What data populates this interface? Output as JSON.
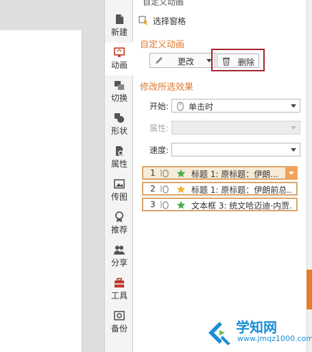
{
  "panel": {
    "title": "自定义动画",
    "select_pane_label": "选择窗格",
    "custom_section_title": "自定义动画",
    "modify_button_label": "更改",
    "delete_button_label": "删除",
    "effect_section_title": "修改所选效果",
    "start_label": "开始:",
    "start_value": "单击时",
    "property_label": "属性:",
    "speed_label": "速度:",
    "speed_value": ""
  },
  "sidebar": {
    "items": [
      {
        "label": "新建",
        "icon": "new-doc-icon"
      },
      {
        "label": "动画",
        "icon": "animation-icon"
      },
      {
        "label": "切换",
        "icon": "transition-icon"
      },
      {
        "label": "形状",
        "icon": "shape-icon"
      },
      {
        "label": "属性",
        "icon": "property-icon"
      },
      {
        "label": "传图",
        "icon": "image-icon"
      },
      {
        "label": "推荐",
        "icon": "recommend-icon"
      },
      {
        "label": "分享",
        "icon": "share-icon"
      },
      {
        "label": "工具",
        "icon": "toolbox-icon"
      },
      {
        "label": "备份",
        "icon": "backup-icon"
      }
    ]
  },
  "animations": [
    {
      "num": "1",
      "text": "标题 1: 原标题：伊朗...",
      "star_color": "#4caf50"
    },
    {
      "num": "2",
      "text": "标题 1: 原标题：伊朗前总...",
      "star_color": "#f2b134"
    },
    {
      "num": "3",
      "text": "文本框 3: 统文哈迈迪·内贾...",
      "star_color": "#4caf50"
    }
  ],
  "watermark": {
    "name": "学知网",
    "url": "www.jmqz1000.com"
  },
  "colors": {
    "accent_orange": "#e0782b",
    "delete_highlight": "#a8222d",
    "watermark_blue": "#1a8ed6"
  }
}
